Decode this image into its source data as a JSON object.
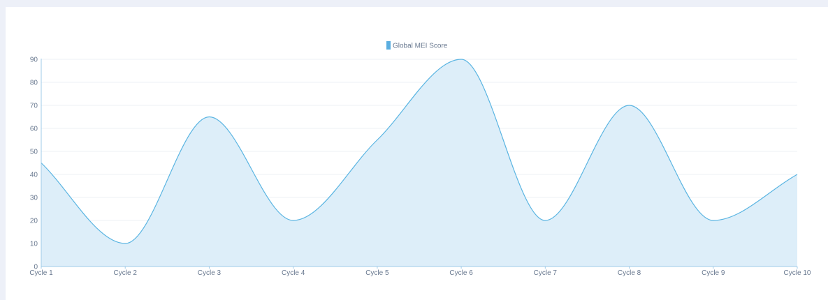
{
  "chart_data": {
    "type": "area",
    "categories": [
      "Cycle 1",
      "Cycle 2",
      "Cycle 3",
      "Cycle 4",
      "Cycle 5",
      "Cycle 6",
      "Cycle 7",
      "Cycle 8",
      "Cycle 9",
      "Cycle 10"
    ],
    "series": [
      {
        "name": "Global MEI Score",
        "values": [
          45,
          10,
          65,
          20,
          55,
          90,
          20,
          70,
          20,
          40
        ]
      }
    ],
    "title": "",
    "xlabel": "",
    "ylabel": "",
    "ylim": [
      0,
      90
    ],
    "yticks": [
      "0",
      "10",
      "20",
      "30",
      "40",
      "50",
      "60",
      "70",
      "80",
      "90"
    ],
    "grid": true,
    "legend_position": "top-center",
    "colors": {
      "line": "#5bb5e2",
      "fill": "#ddeef9",
      "legend_swatch": "#5aaee0",
      "grid": "#edf0f4",
      "axis": "#9fcbe8",
      "background": "#edf0f8",
      "panel": "#ffffff"
    }
  }
}
